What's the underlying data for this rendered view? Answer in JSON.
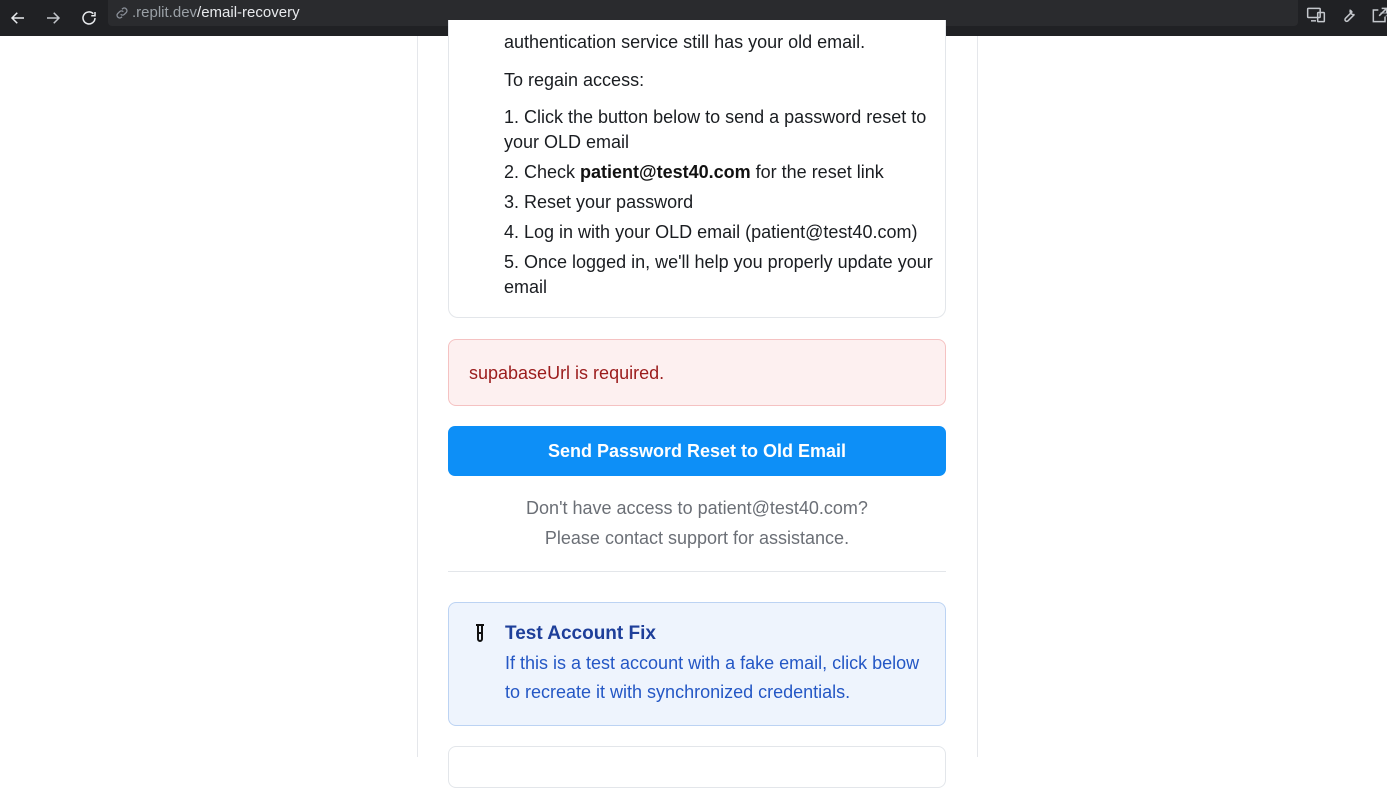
{
  "browser": {
    "url_host": ".replit.dev",
    "url_path": "/email-recovery",
    "icons": [
      "back-arrow-icon",
      "forward-arrow-icon",
      "reload-icon",
      "link-icon",
      "send-to-icon",
      "device-icon",
      "wrench-icon",
      "open-external-icon"
    ]
  },
  "instructions": {
    "partial_line": "authentication service still has your old email.",
    "heading": "To regain access:",
    "step1_a": "1. Click the button below to send a password reset to",
    "step1_b": "your OLD email",
    "step2_prefix": "2. Check ",
    "step2_email": "patient@test40.com",
    "step2_suffix": " for the reset link",
    "step3": "3. Reset your password",
    "step4": "4. Log in with your OLD email (patient@test40.com)",
    "step5_a": "5. Once logged in, we'll help you properly update your",
    "step5_b": "email"
  },
  "error": {
    "message": "supabaseUrl is required."
  },
  "actions": {
    "send_reset_label": "Send Password Reset to Old Email"
  },
  "help": {
    "line1": "Don't have access to patient@test40.com?",
    "line2": "Please contact support for assistance."
  },
  "test_fix": {
    "icon": "test-tube-icon",
    "title": "Test Account Fix",
    "body": "If this is a test account with a fake email, click below to recreate it with synchronized credentials."
  },
  "colors": {
    "primary": "#0d8ff7",
    "error_bg": "#fdf0f0",
    "error_text": "#9b1c1c",
    "info_bg": "#eef4fd",
    "info_title": "#1e3f9a",
    "info_text": "#2457c5"
  }
}
